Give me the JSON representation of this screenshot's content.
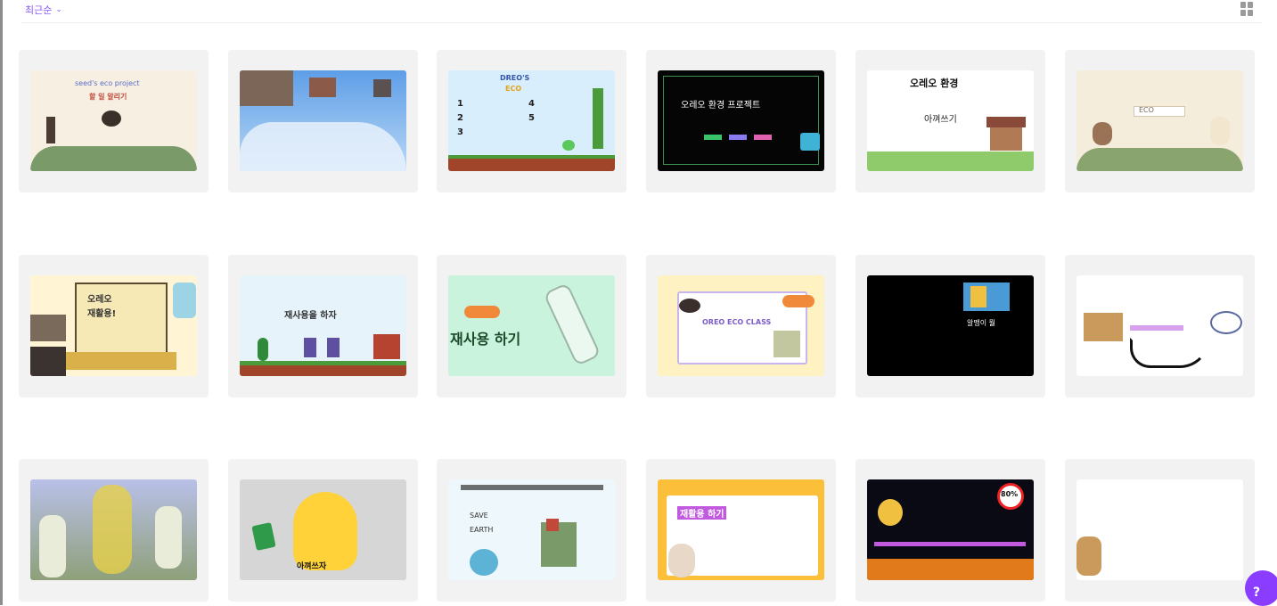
{
  "toolbar": {
    "sort_label": "최근순"
  },
  "designs": [
    {
      "id": "d1",
      "lines": [
        "seed's eco project",
        "할 일 알리기"
      ]
    },
    {
      "id": "d2",
      "lines": []
    },
    {
      "id": "d3",
      "lines": [
        "DREO'S",
        "ECO",
        "1",
        "2",
        "3",
        "4",
        "5"
      ]
    },
    {
      "id": "d4",
      "lines": [
        "오레오 환경 프로젝트"
      ]
    },
    {
      "id": "d5",
      "lines": [
        "오레오 환경",
        "아껴쓰기"
      ]
    },
    {
      "id": "d6",
      "lines": [
        "ECO"
      ]
    },
    {
      "id": "d7",
      "lines": [
        "오레오",
        "재활용!"
      ]
    },
    {
      "id": "d8",
      "lines": [
        "재사용을 하자"
      ]
    },
    {
      "id": "d9",
      "lines": [
        "재사용 하기"
      ]
    },
    {
      "id": "d10",
      "lines": [
        "OREO ECO CLASS"
      ]
    },
    {
      "id": "d11",
      "lines": [
        "알맹이 뭘"
      ]
    },
    {
      "id": "d12",
      "lines": []
    },
    {
      "id": "d13",
      "lines": []
    },
    {
      "id": "d14",
      "lines": [
        "아껴쓰자"
      ]
    },
    {
      "id": "d15",
      "lines": [
        "SAVE",
        "EARTH"
      ]
    },
    {
      "id": "d16",
      "lines": [
        "재활용 하기"
      ]
    },
    {
      "id": "d17",
      "lines": [
        "80%"
      ]
    },
    {
      "id": "d18",
      "lines": []
    }
  ],
  "fab": {
    "label": "?"
  }
}
